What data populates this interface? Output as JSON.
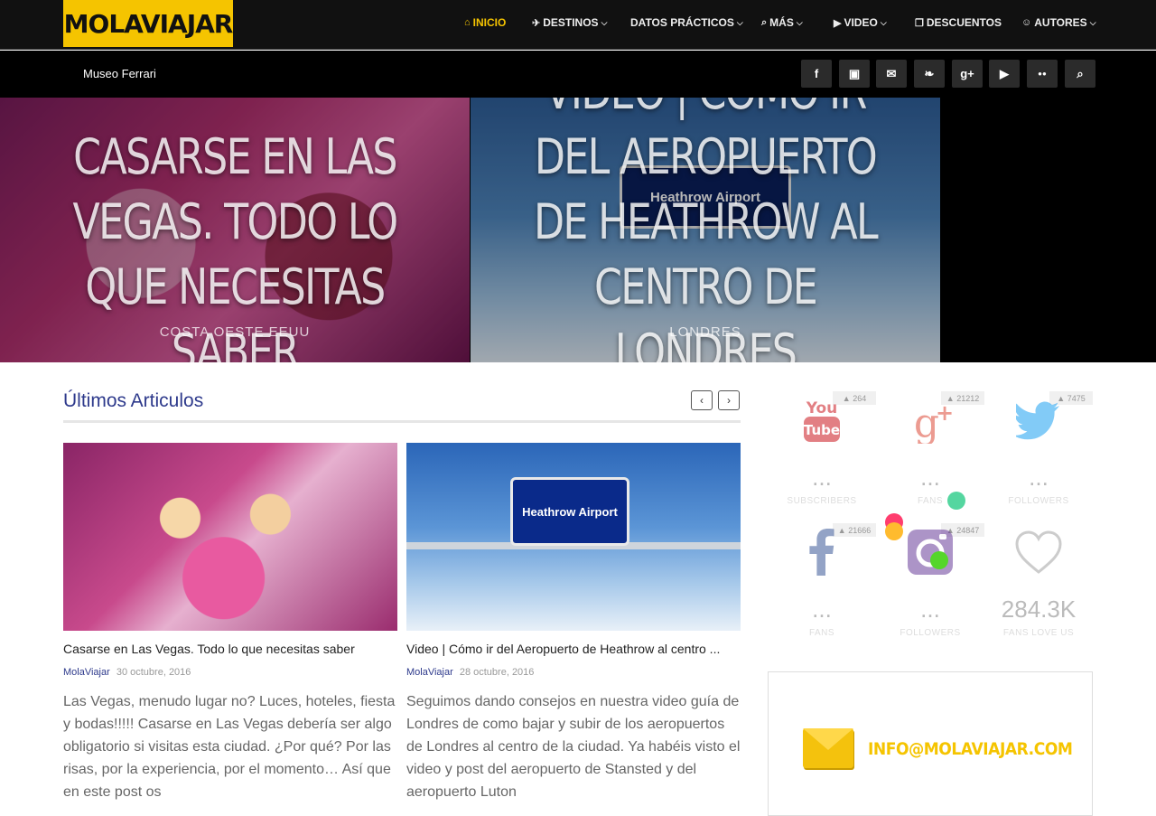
{
  "brand": {
    "logo_text": "MOLAVIAJAR",
    "accent": "#f5c400",
    "link_color": "#2e3a8c"
  },
  "nav": {
    "items": [
      {
        "label": "INICIO",
        "icon": "home-icon",
        "glyph": "⌂",
        "dropdown": false,
        "active": true
      },
      {
        "label": "DESTINOS",
        "icon": "plane-icon",
        "glyph": "✈",
        "dropdown": true
      },
      {
        "label": "DATOS PRÁCTICOS",
        "icon": "",
        "glyph": "",
        "dropdown": true
      },
      {
        "label": "MÁS",
        "icon": "search-icon",
        "glyph": "⌕",
        "dropdown": true
      },
      {
        "label": "VIDEO",
        "icon": "youtube-play-icon",
        "glyph": "▶",
        "dropdown": true
      },
      {
        "label": "DESCUENTOS",
        "icon": "gift-icon",
        "glyph": "❐",
        "dropdown": false
      },
      {
        "label": "AUTORES",
        "icon": "users-icon",
        "glyph": "☺",
        "dropdown": true
      }
    ]
  },
  "subbar": {
    "ticker_text": "Museo Ferrari",
    "social": [
      {
        "name": "facebook-icon",
        "glyph": "f"
      },
      {
        "name": "instagram-icon",
        "glyph": "▣"
      },
      {
        "name": "envelope-icon",
        "glyph": "✉"
      },
      {
        "name": "twitter-icon",
        "glyph": "❧"
      },
      {
        "name": "google-plus-icon",
        "glyph": "g+"
      },
      {
        "name": "youtube-icon",
        "glyph": "▶"
      },
      {
        "name": "flickr-icon",
        "glyph": "●●"
      },
      {
        "name": "search-icon",
        "glyph": "⌕"
      }
    ]
  },
  "hero": {
    "slides": [
      {
        "title": "Casarse en Las Vegas. Todo lo que necesitas saber",
        "category": "Costa Oeste EEUU"
      },
      {
        "title": "Video | Cómo ir del Aeropuerto de Heathrow al centro de Londres",
        "category": "Londres",
        "sign_text": "Heathrow Airport"
      }
    ]
  },
  "latest": {
    "heading": "Últimos Articulos",
    "prev_glyph": "‹",
    "next_glyph": "›",
    "articles": [
      {
        "title": "Casarse en Las Vegas. Todo lo que necesitas saber",
        "author": "MolaViajar",
        "date": "30 octubre, 2016",
        "excerpt": "Las Vegas, menudo lugar no? Luces, hoteles, fiesta y bodas!!!!! Casarse en Las Vegas debería ser algo obligatorio si visitas esta ciudad. ¿Por qué? Por las risas, por la experiencia, por el momento… Así que en este post os"
      },
      {
        "title": "Video | Cómo ir del Aeropuerto de Heathrow al centro ...",
        "author": "MolaViajar",
        "date": "28 octubre, 2016",
        "image_text": "Heathrow Airport",
        "excerpt": "Seguimos dando consejos en nuestra video guía de Londres de como bajar y subir de los aeropuertos de Londres al centro de la ciudad. Ya habéis visto el video y post del aeropuerto de Stansted y del aeropuerto Luton"
      }
    ]
  },
  "counters": [
    {
      "name": "youtube",
      "badge": "▲ 264",
      "value": "...",
      "label": "SUBSCRIBERS",
      "color": "#cc181e"
    },
    {
      "name": "google-plus",
      "badge": "▲ 21212",
      "value": "...",
      "label": "FANS",
      "color": "#dd4b39"
    },
    {
      "name": "twitter",
      "badge": "▲ 7475",
      "value": "...",
      "label": "FOLLOWERS",
      "color": "#1da1f2"
    },
    {
      "name": "facebook",
      "badge": "▲ 21666",
      "value": "...",
      "label": "FANS",
      "color": "#3b5998"
    },
    {
      "name": "instagram",
      "badge": "▲ 24847",
      "value": "...",
      "label": "FOLLOWERS",
      "color": "#6a3d9a"
    },
    {
      "name": "love",
      "badge": "",
      "value": "284.3K",
      "label": "FANS LOVE US",
      "color": "#cccccc"
    }
  ],
  "email_banner": {
    "text": "INFO@MOLAVIAJAR.COM"
  }
}
